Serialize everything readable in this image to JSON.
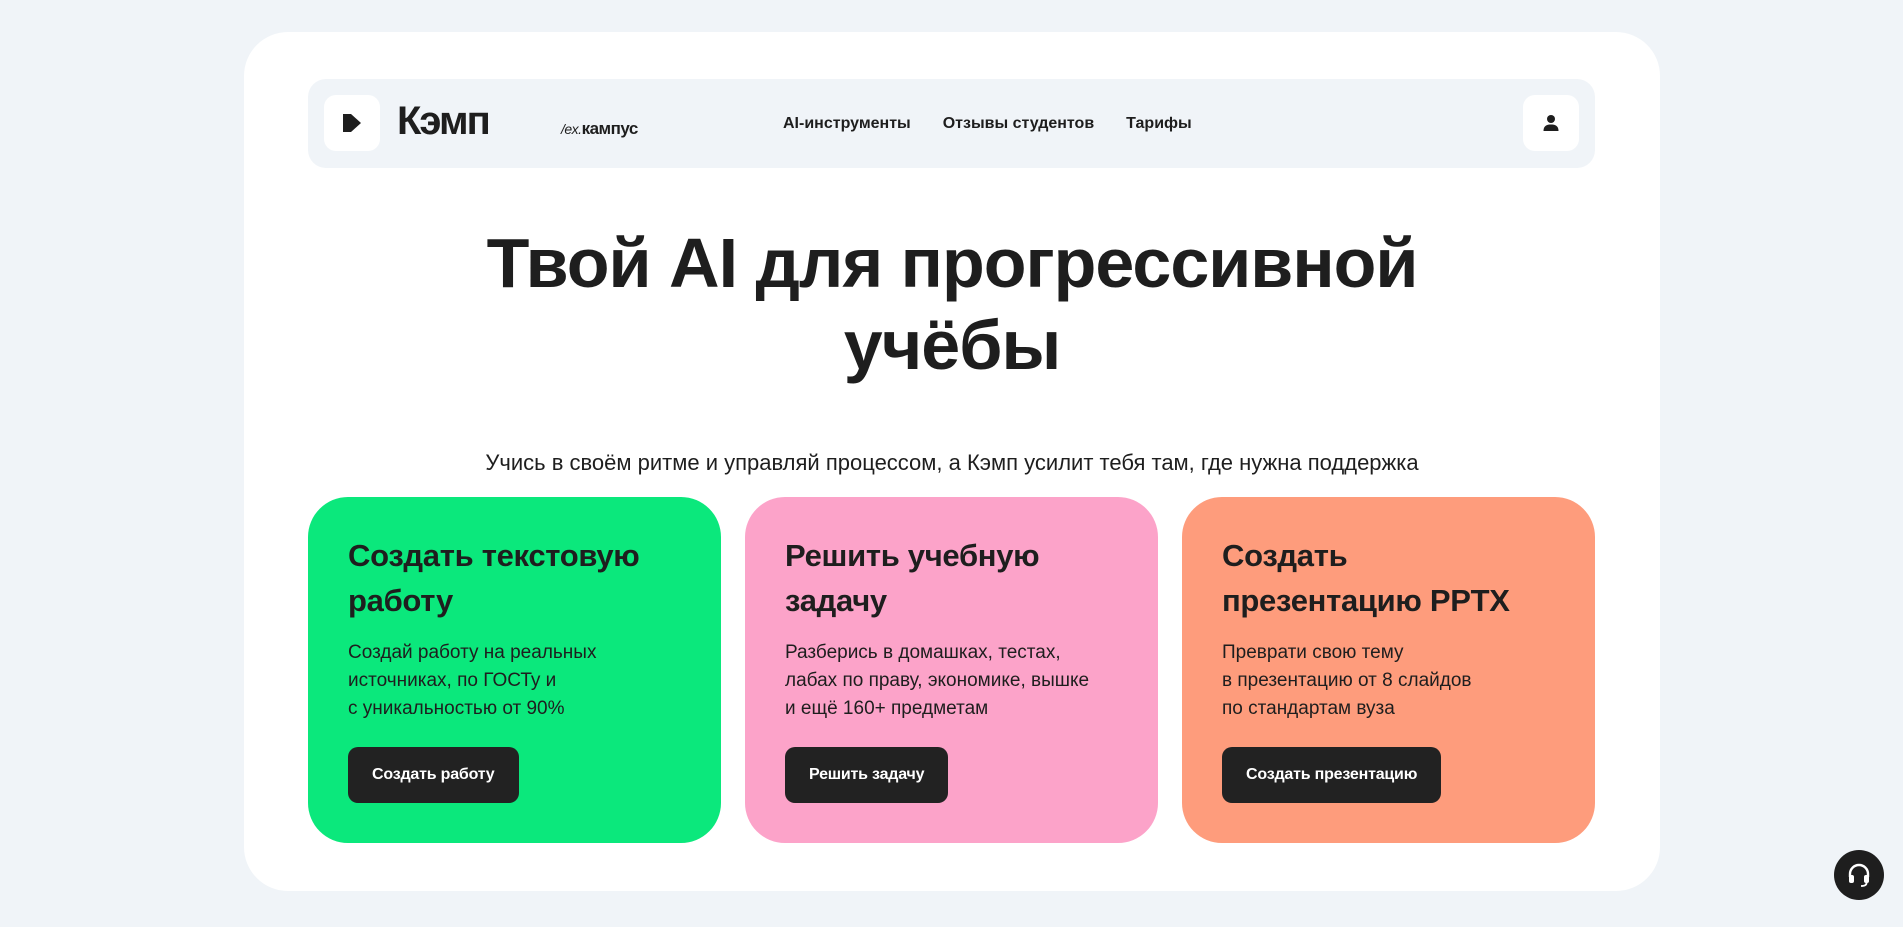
{
  "header": {
    "brand_name": "Кэмп",
    "brand_ex_prefix": "/ex.",
    "brand_ex_name": "кампус",
    "nav": [
      {
        "label": "AI-инструменты"
      },
      {
        "label": "Отзывы студентов"
      },
      {
        "label": "Тарифы"
      }
    ],
    "icons": {
      "logo": "logo-k-icon",
      "profile": "user-icon"
    }
  },
  "hero": {
    "title_line1": "Твой AI для прогрессивной",
    "title_line2": "учёбы",
    "subtitle": "Учись в своём ритме и управляй процессом, а Кэмп усилит тебя там, где нужна поддержка"
  },
  "cards": [
    {
      "title": "Создать текстовую работу",
      "text": "Создай работу на реальных\nисточниках, по ГОСТу и\nс уникальностью от 90%",
      "button": "Создать работу",
      "color": "#0be87c"
    },
    {
      "title": "Решить учебную задачу",
      "text": "Разберись в домашках, тестах,\nлабах по праву, экономике, вышке\nи ещё 160+ предметам",
      "button": "Решить задачу",
      "color": "#fca3c9"
    },
    {
      "title": "Создать презентацию PPTX",
      "text": "Преврати свою тему\nв презентацию от 8 слайдов\nпо стандартам вуза",
      "button": "Создать презентацию",
      "color": "#fe9c7c"
    }
  ],
  "support": {
    "icon": "headset-icon"
  },
  "colors": {
    "page_bg": "#f0f4f8",
    "frame_bg": "#ffffff",
    "text": "#1e1e1e",
    "button_bg": "#222222"
  }
}
